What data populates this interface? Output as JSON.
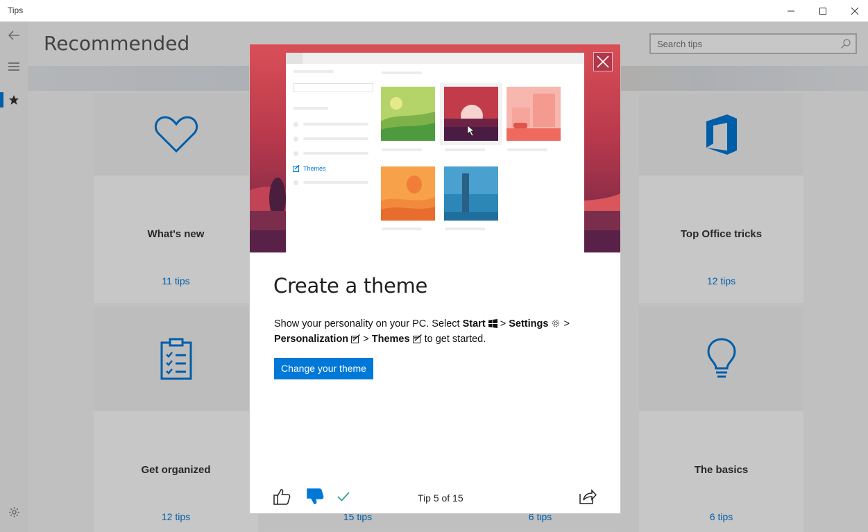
{
  "window": {
    "title": "Tips",
    "minimize_icon": "minimize-icon",
    "maximize_icon": "maximize-icon",
    "close_icon": "close-icon"
  },
  "nav": {
    "back_icon": "back-arrow-icon",
    "menu_icon": "hamburger-menu-icon",
    "recommended_icon": "star-icon",
    "settings_icon": "gear-icon",
    "accent": "#0078d7"
  },
  "page": {
    "title": "Recommended",
    "search_placeholder": "Search tips",
    "search_icon": "search-icon"
  },
  "cards": [
    {
      "title": "What's new",
      "count": "11 tips",
      "icon": "heart-icon"
    },
    {
      "title": "Top Office tricks",
      "count": "12 tips",
      "icon": "office-logo-icon"
    },
    {
      "title": "Get organized",
      "count": "12 tips",
      "icon": "clipboard-checklist-icon"
    },
    {
      "title": "The basics",
      "count": "6 tips",
      "icon": "lightbulb-icon"
    },
    {
      "title": "",
      "count": "15 tips",
      "icon": ""
    },
    {
      "title": "",
      "count": "6 tips",
      "icon": ""
    }
  ],
  "dialog": {
    "mock_sidebar_label": "Themes",
    "title": "Create a theme",
    "body": {
      "t1": "Show your personality on your PC. Select ",
      "start": "Start",
      "sep1": " > ",
      "settings": "Settings",
      "sep2": " > ",
      "personalization": "Personalization",
      "sep3": " > ",
      "themes": "Themes",
      "t2": " to get started."
    },
    "cta_label": "Change your theme",
    "tip_counter": "Tip 5 of 15",
    "icons": {
      "close": "close-icon",
      "like": "thumbs-up-icon",
      "dislike": "thumbs-down-icon",
      "tried": "checkmark-icon",
      "share": "share-icon"
    },
    "colors": {
      "hero_top": "#d94f56",
      "hero_bottom": "#5c2247",
      "button": "#0078d7",
      "check": "#2f9e8f"
    }
  }
}
